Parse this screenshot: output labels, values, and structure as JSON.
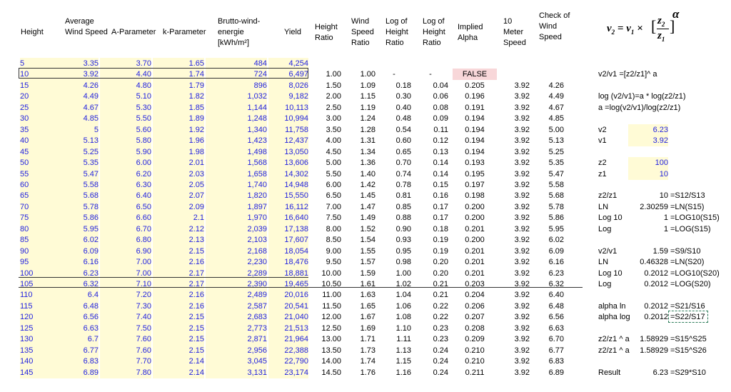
{
  "headers": {
    "height": "Height",
    "avg_wind": "Average Wind Speed",
    "a_param": "A-Parameter",
    "k_param": "k-Parameter",
    "brutto": "Brutto-wind-energie [kWh/m²]",
    "yield": "Yield",
    "height_ratio": "Height Ratio",
    "wind_ratio": "Wind Speed Ratio",
    "log_height": "Log of Height Ratio",
    "log_height2": "Log of Height Ratio",
    "implied_alpha": "Implied Alpha",
    "ten_meter": "10 Meter Speed",
    "check": "Check of Wind Speed"
  },
  "rows": [
    [
      "5",
      "3.35",
      "3.70",
      "1.65",
      "484",
      "4,254",
      "",
      "",
      "",
      "",
      "",
      "",
      ""
    ],
    [
      "10",
      "3.92",
      "4.40",
      "1.74",
      "724",
      "6,497",
      "1.00",
      "1.00",
      "-",
      "-",
      "FALSE",
      "",
      ""
    ],
    [
      "15",
      "4.26",
      "4.80",
      "1.79",
      "896",
      "8,026",
      "1.50",
      "1.09",
      "0.18",
      "0.04",
      "0.205",
      "3.92",
      "4.26"
    ],
    [
      "20",
      "4.49",
      "5.10",
      "1.82",
      "1,032",
      "9,182",
      "2.00",
      "1.15",
      "0.30",
      "0.06",
      "0.196",
      "3.92",
      "4.49"
    ],
    [
      "25",
      "4.67",
      "5.30",
      "1.85",
      "1,144",
      "10,113",
      "2.50",
      "1.19",
      "0.40",
      "0.08",
      "0.191",
      "3.92",
      "4.67"
    ],
    [
      "30",
      "4.85",
      "5.50",
      "1.89",
      "1,248",
      "10,994",
      "3.00",
      "1.24",
      "0.48",
      "0.09",
      "0.194",
      "3.92",
      "4.85"
    ],
    [
      "35",
      "5",
      "5.60",
      "1.92",
      "1,340",
      "11,758",
      "3.50",
      "1.28",
      "0.54",
      "0.11",
      "0.194",
      "3.92",
      "5.00"
    ],
    [
      "40",
      "5.13",
      "5.80",
      "1.96",
      "1,423",
      "12,437",
      "4.00",
      "1.31",
      "0.60",
      "0.12",
      "0.194",
      "3.92",
      "5.13"
    ],
    [
      "45",
      "5.25",
      "5.90",
      "1.98",
      "1,498",
      "13,050",
      "4.50",
      "1.34",
      "0.65",
      "0.13",
      "0.194",
      "3.92",
      "5.25"
    ],
    [
      "50",
      "5.35",
      "6.00",
      "2.01",
      "1,568",
      "13,606",
      "5.00",
      "1.36",
      "0.70",
      "0.14",
      "0.193",
      "3.92",
      "5.35"
    ],
    [
      "55",
      "5.47",
      "6.20",
      "2.03",
      "1,658",
      "14,302",
      "5.50",
      "1.40",
      "0.74",
      "0.14",
      "0.195",
      "3.92",
      "5.47"
    ],
    [
      "60",
      "5.58",
      "6.30",
      "2.05",
      "1,740",
      "14,948",
      "6.00",
      "1.42",
      "0.78",
      "0.15",
      "0.197",
      "3.92",
      "5.58"
    ],
    [
      "65",
      "5.68",
      "6.40",
      "2.07",
      "1,820",
      "15,550",
      "6.50",
      "1.45",
      "0.81",
      "0.16",
      "0.198",
      "3.92",
      "5.68"
    ],
    [
      "70",
      "5.78",
      "6.50",
      "2.09",
      "1,897",
      "16,112",
      "7.00",
      "1.47",
      "0.85",
      "0.17",
      "0.200",
      "3.92",
      "5.78"
    ],
    [
      "75",
      "5.86",
      "6.60",
      "2.1",
      "1,970",
      "16,640",
      "7.50",
      "1.49",
      "0.88",
      "0.17",
      "0.200",
      "3.92",
      "5.86"
    ],
    [
      "80",
      "5.95",
      "6.70",
      "2.12",
      "2,039",
      "17,138",
      "8.00",
      "1.52",
      "0.90",
      "0.18",
      "0.201",
      "3.92",
      "5.95"
    ],
    [
      "85",
      "6.02",
      "6.80",
      "2.13",
      "2,103",
      "17,607",
      "8.50",
      "1.54",
      "0.93",
      "0.19",
      "0.200",
      "3.92",
      "6.02"
    ],
    [
      "90",
      "6.09",
      "6.90",
      "2.15",
      "2,168",
      "18,054",
      "9.00",
      "1.55",
      "0.95",
      "0.19",
      "0.201",
      "3.92",
      "6.09"
    ],
    [
      "95",
      "6.16",
      "7.00",
      "2.16",
      "2,230",
      "18,476",
      "9.50",
      "1.57",
      "0.98",
      "0.20",
      "0.201",
      "3.92",
      "6.16"
    ],
    [
      "100",
      "6.23",
      "7.00",
      "2.17",
      "2,289",
      "18,881",
      "10.00",
      "1.59",
      "1.00",
      "0.20",
      "0.201",
      "3.92",
      "6.23"
    ],
    [
      "105",
      "6.32",
      "7.10",
      "2.17",
      "2,390",
      "19,465",
      "10.50",
      "1.61",
      "1.02",
      "0.21",
      "0.203",
      "3.92",
      "6.32"
    ],
    [
      "110",
      "6.4",
      "7.20",
      "2.16",
      "2,489",
      "20,016",
      "11.00",
      "1.63",
      "1.04",
      "0.21",
      "0.204",
      "3.92",
      "6.40"
    ],
    [
      "115",
      "6.48",
      "7.30",
      "2.16",
      "2,587",
      "20,541",
      "11.50",
      "1.65",
      "1.06",
      "0.22",
      "0.206",
      "3.92",
      "6.48"
    ],
    [
      "120",
      "6.56",
      "7.40",
      "2.15",
      "2,683",
      "21,040",
      "12.00",
      "1.67",
      "1.08",
      "0.22",
      "0.207",
      "3.92",
      "6.56"
    ],
    [
      "125",
      "6.63",
      "7.50",
      "2.15",
      "2,773",
      "21,513",
      "12.50",
      "1.69",
      "1.10",
      "0.23",
      "0.208",
      "3.92",
      "6.63"
    ],
    [
      "130",
      "6.7",
      "7.60",
      "2.15",
      "2,871",
      "21,964",
      "13.00",
      "1.71",
      "1.11",
      "0.23",
      "0.209",
      "3.92",
      "6.70"
    ],
    [
      "135",
      "6.77",
      "7.60",
      "2.15",
      "2,956",
      "22,388",
      "13.50",
      "1.73",
      "1.13",
      "0.24",
      "0.210",
      "3.92",
      "6.77"
    ],
    [
      "140",
      "6.83",
      "7.70",
      "2.14",
      "3,045",
      "22,790",
      "14.00",
      "1.74",
      "1.15",
      "0.24",
      "0.210",
      "3.92",
      "6.83"
    ],
    [
      "145",
      "6.89",
      "7.80",
      "2.14",
      "3,131",
      "23,174",
      "14.50",
      "1.76",
      "1.16",
      "0.24",
      "0.211",
      "3.92",
      "6.89"
    ]
  ],
  "formula": {
    "lhs": "v",
    "sub2": "2",
    "eq": " = v",
    "sub1": "1",
    "times": " × ",
    "z2": "z",
    "z2sub": "2",
    "z1": "z",
    "z1sub": "1",
    "alpha": "α"
  },
  "side": [
    {
      "row": 1,
      "label": "v2/v1 =[z2/z1]^ a",
      "value": "",
      "note": ""
    },
    {
      "row": 3,
      "label": "log (v2/v1)=a * log(z2/z1)",
      "value": "",
      "note": ""
    },
    {
      "row": 4,
      "label": "a =log(v2/v1)/log(z2/z1)",
      "value": "",
      "note": ""
    },
    {
      "row": 6,
      "label": "v2",
      "value": "6.23",
      "note": "",
      "inputY": true
    },
    {
      "row": 7,
      "label": "v1",
      "value": "3.92",
      "note": "",
      "inputY": true
    },
    {
      "row": 9,
      "label": "z2",
      "value": "100",
      "note": "",
      "inputY": true
    },
    {
      "row": 10,
      "label": "z1",
      "value": "10",
      "note": "",
      "inputY": true
    },
    {
      "row": 12,
      "label": "z2/z1",
      "value": "10",
      "note": "=S12/S13"
    },
    {
      "row": 13,
      "label": "LN",
      "value": "2.30259",
      "note": "=LN(S15)"
    },
    {
      "row": 14,
      "label": "Log 10",
      "value": "1",
      "note": "=LOG10(S15)"
    },
    {
      "row": 15,
      "label": "Log",
      "value": "1",
      "note": "=LOG(S15)"
    },
    {
      "row": 17,
      "label": "v2/v1",
      "value": "1.59",
      "note": "=S9/S10"
    },
    {
      "row": 18,
      "label": "LN",
      "value": "0.46328",
      "note": "=LN(S20)"
    },
    {
      "row": 19,
      "label": "Log 10",
      "value": "0.2012",
      "note": "=LOG10(S20)"
    },
    {
      "row": 20,
      "label": "Log",
      "value": "0.2012",
      "note": "=LOG(S20)"
    },
    {
      "row": 22,
      "label": "alpha ln",
      "value": "0.2012",
      "note": "=S21/S16"
    },
    {
      "row": 23,
      "label": "alpha log",
      "value": "0.2012",
      "note": "=S22/S17"
    },
    {
      "row": 25,
      "label": "z2/z1 ^ a",
      "value": "1.58929",
      "note": "=S15^S25"
    },
    {
      "row": 26,
      "label": "z2/z1 ^ a",
      "value": "1.58929",
      "note": "=S15^S26"
    },
    {
      "row": 28,
      "label": "Result",
      "value": "6.23",
      "note": "=S29*S10"
    }
  ]
}
